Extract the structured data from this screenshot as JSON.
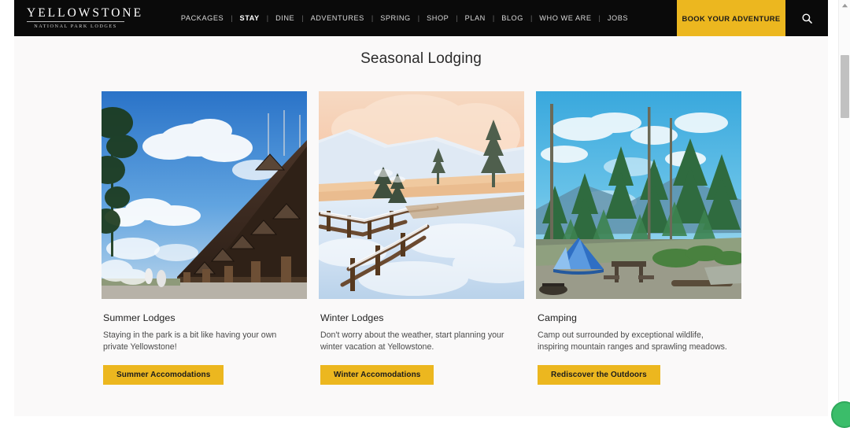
{
  "header": {
    "logo": {
      "main": "YELLOWSTONE",
      "sub": "NATIONAL PARK LODGES"
    },
    "nav": [
      {
        "label": "PACKAGES",
        "active": false
      },
      {
        "label": "STAY",
        "active": true
      },
      {
        "label": "DINE",
        "active": false
      },
      {
        "label": "ADVENTURES",
        "active": false
      },
      {
        "label": "SPRING",
        "active": false
      },
      {
        "label": "SHOP",
        "active": false
      },
      {
        "label": "PLAN",
        "active": false
      },
      {
        "label": "BLOG",
        "active": false
      },
      {
        "label": "WHO WE ARE",
        "active": false
      },
      {
        "label": "JOBS",
        "active": false
      }
    ],
    "separator": "|",
    "cta_label": "BOOK YOUR ADVENTURE",
    "search_icon": "search-icon",
    "accent_color": "#ecb71f",
    "background_color": "#0a0a0a"
  },
  "main": {
    "title": "Seasonal Lodging",
    "cards": [
      {
        "image_name": "summer-lodge-photo",
        "image_alt": "Old Faithful Inn log lodge under blue sky with clouds",
        "title": "Summer Lodges",
        "description": "Staying in the park is a bit like having your own private Yellowstone!",
        "button_label": "Summer Accomodations"
      },
      {
        "image_name": "winter-lodge-photo",
        "image_alt": "Snow covered boardwalk at Mammoth Hot Springs at sunrise",
        "title": "Winter Lodges",
        "description": "Don't worry about the weather, start planning your winter vacation at Yellowstone.",
        "button_label": "Winter Accomodations"
      },
      {
        "image_name": "camping-photo",
        "image_alt": "Blue dome tent and picnic table at a forest campsite",
        "title": "Camping",
        "description": "Camp out surrounded by exceptional wildlife, inspiring mountain ranges and sprawling meadows.",
        "button_label": "Rediscover the Outdoors"
      }
    ]
  },
  "scrollbar": {
    "up_arrow_icon": "chevron-up-icon",
    "thumb_name": "scrollbar-thumb"
  },
  "page": {
    "background_color": "#faf9f9"
  }
}
